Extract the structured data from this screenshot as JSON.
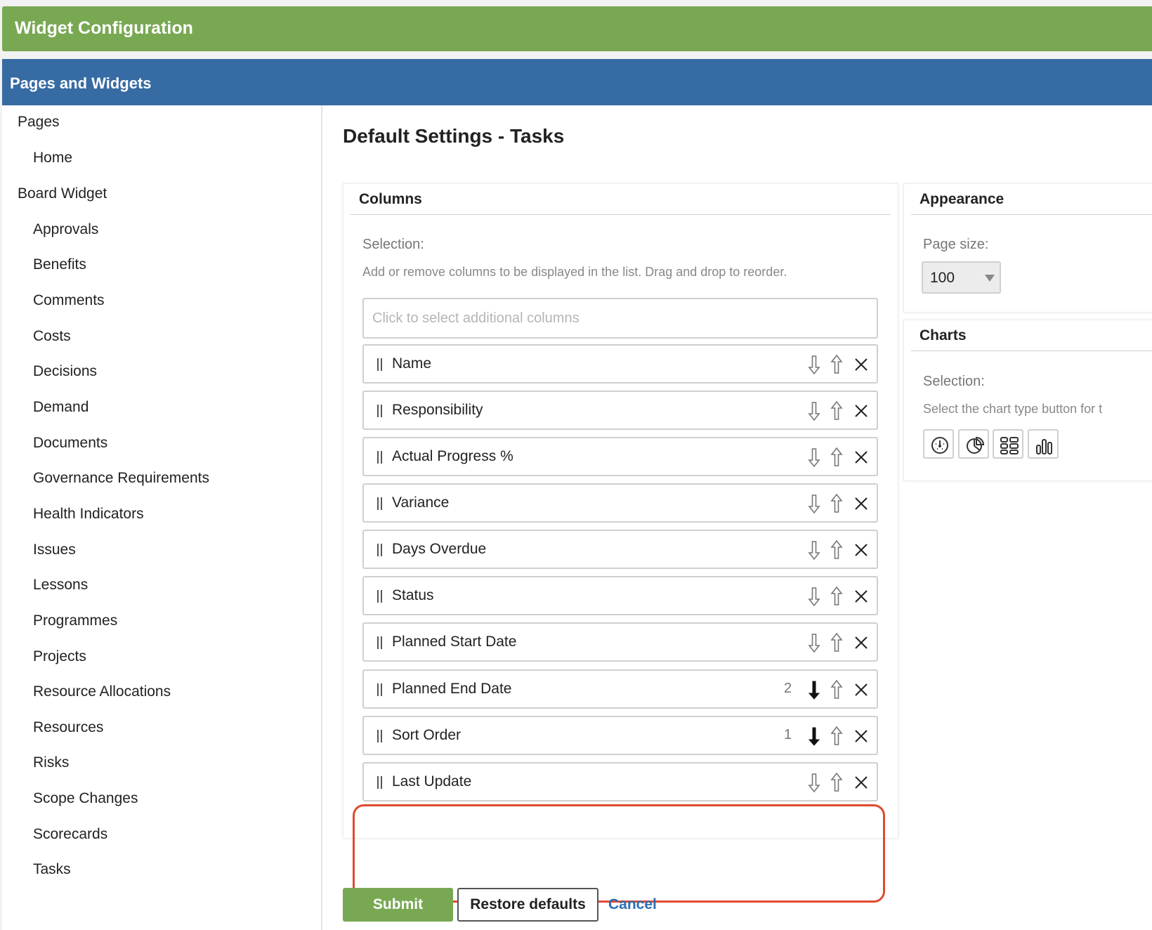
{
  "header": {
    "title": "Widget Configuration"
  },
  "subheader": {
    "title": "Pages and Widgets"
  },
  "sidebar": {
    "items": [
      {
        "label": "Pages",
        "level": 0
      },
      {
        "label": "Home",
        "level": 1
      },
      {
        "label": "Board Widget",
        "level": 0
      },
      {
        "label": "Approvals",
        "level": 1
      },
      {
        "label": "Benefits",
        "level": 1
      },
      {
        "label": "Comments",
        "level": 1
      },
      {
        "label": "Costs",
        "level": 1
      },
      {
        "label": "Decisions",
        "level": 1
      },
      {
        "label": "Demand",
        "level": 1
      },
      {
        "label": "Documents",
        "level": 1
      },
      {
        "label": "Governance Requirements",
        "level": 1
      },
      {
        "label": "Health Indicators",
        "level": 1
      },
      {
        "label": "Issues",
        "level": 1
      },
      {
        "label": "Lessons",
        "level": 1
      },
      {
        "label": "Programmes",
        "level": 1
      },
      {
        "label": "Projects",
        "level": 1
      },
      {
        "label": "Resource Allocations",
        "level": 1
      },
      {
        "label": "Resources",
        "level": 1
      },
      {
        "label": "Risks",
        "level": 1
      },
      {
        "label": "Scope Changes",
        "level": 1
      },
      {
        "label": "Scorecards",
        "level": 1
      },
      {
        "label": "Tasks",
        "level": 1
      }
    ]
  },
  "main": {
    "page_title": "Default Settings - Tasks",
    "columns_panel": {
      "title": "Columns",
      "selection_label": "Selection:",
      "help_text": "Add or remove columns to be displayed in the list. Drag and drop to reorder.",
      "input_placeholder": "Click to select additional columns",
      "rows": [
        {
          "label": "Name",
          "sort_number": "",
          "sorted": false
        },
        {
          "label": "Responsibility",
          "sort_number": "",
          "sorted": false
        },
        {
          "label": "Actual Progress %",
          "sort_number": "",
          "sorted": false
        },
        {
          "label": "Variance",
          "sort_number": "",
          "sorted": false
        },
        {
          "label": "Days Overdue",
          "sort_number": "",
          "sorted": false
        },
        {
          "label": "Status",
          "sort_number": "",
          "sorted": false
        },
        {
          "label": "Planned Start Date",
          "sort_number": "",
          "sorted": false
        },
        {
          "label": "Planned End Date",
          "sort_number": "2",
          "sorted": true
        },
        {
          "label": "Sort Order",
          "sort_number": "1",
          "sorted": true
        },
        {
          "label": "Last Update",
          "sort_number": "",
          "sorted": false
        }
      ]
    },
    "appearance_panel": {
      "title": "Appearance",
      "page_size_label": "Page size:",
      "page_size_value": "100"
    },
    "charts_panel": {
      "title": "Charts",
      "selection_label": "Selection:",
      "help_text": "Select the chart type button for t",
      "chart_buttons": [
        "gauge-chart-icon",
        "pie-chart-icon",
        "grid-chart-icon",
        "bar-chart-icon"
      ]
    },
    "actions": {
      "submit_label": "Submit",
      "restore_label": "Restore defaults",
      "cancel_label": "Cancel"
    }
  },
  "colors": {
    "header_green": "#79a853",
    "subheader_blue": "#376ba3",
    "highlight_red": "#e04a2f",
    "link_blue": "#2c6fb7"
  }
}
